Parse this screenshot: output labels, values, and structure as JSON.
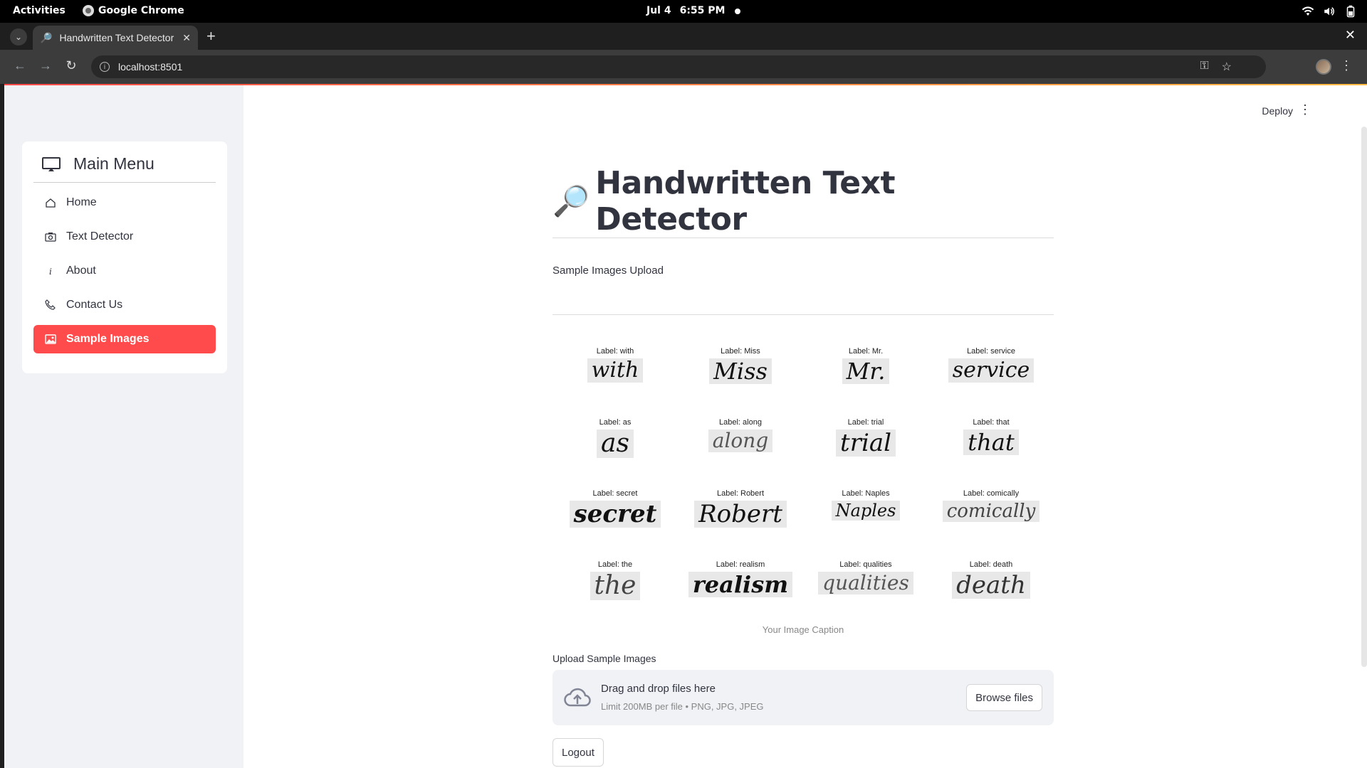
{
  "system_bar": {
    "activities": "Activities",
    "app_name": "Google Chrome",
    "date": "Jul 4",
    "time": "6:55 PM"
  },
  "browser": {
    "tab_title": "Handwritten Text Detector",
    "url": "localhost:8501"
  },
  "sidebar": {
    "menu_title": "Main Menu",
    "items": [
      {
        "label": "Home",
        "icon": "house-icon",
        "active": false
      },
      {
        "label": "Text Detector",
        "icon": "camera-icon",
        "active": false
      },
      {
        "label": "About",
        "icon": "info-icon",
        "active": false
      },
      {
        "label": "Contact Us",
        "icon": "phone-icon",
        "active": false
      },
      {
        "label": "Sample Images",
        "icon": "image-icon",
        "active": true
      }
    ]
  },
  "header": {
    "deploy_label": "Deploy"
  },
  "main": {
    "title": "Handwritten Text Detector",
    "title_icon": "magnifier-icon",
    "section_label": "Sample Images Upload",
    "samples": [
      {
        "label": "Label: with",
        "word": "with"
      },
      {
        "label": "Label: Miss",
        "word": "Miss"
      },
      {
        "label": "Label: Mr.",
        "word": "Mr."
      },
      {
        "label": "Label: service",
        "word": "service"
      },
      {
        "label": "Label: as",
        "word": "as"
      },
      {
        "label": "Label: along",
        "word": "along"
      },
      {
        "label": "Label: trial",
        "word": "trial"
      },
      {
        "label": "Label: that",
        "word": "that"
      },
      {
        "label": "Label: secret",
        "word": "secret"
      },
      {
        "label": "Label: Robert",
        "word": "Robert"
      },
      {
        "label": "Label: Naples",
        "word": "Naples"
      },
      {
        "label": "Label: comically",
        "word": "comically"
      },
      {
        "label": "Label: the",
        "word": "the"
      },
      {
        "label": "Label: realism",
        "word": "realism"
      },
      {
        "label": "Label: qualities",
        "word": "qualities"
      },
      {
        "label": "Label: death",
        "word": "death"
      }
    ],
    "caption": "Your Image Caption",
    "upload_label": "Upload Sample Images",
    "dropzone_title": "Drag and drop files here",
    "dropzone_sub": "Limit 200MB per file • PNG, JPG, JPEG",
    "browse_label": "Browse files",
    "logout_label": "Logout"
  },
  "colors": {
    "accent": "#ff4b4b",
    "sidebar_bg": "#f0f2f6",
    "text": "#31333f"
  }
}
